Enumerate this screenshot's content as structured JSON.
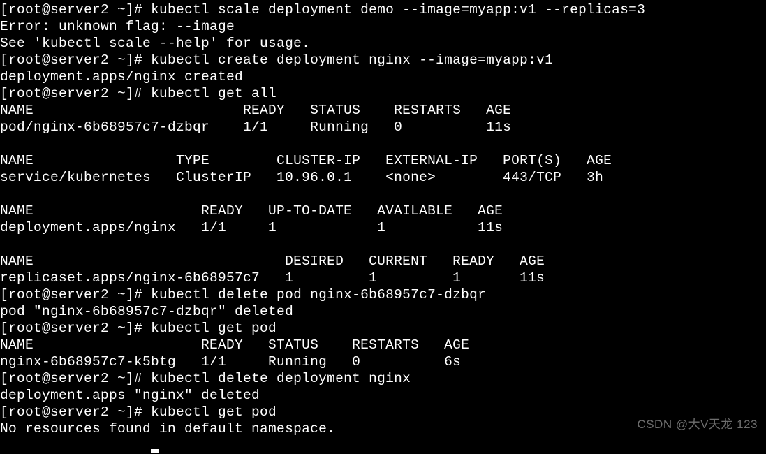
{
  "prompt": "[root@server2 ~]# ",
  "blocks": [
    {
      "cmd": "kubectl scale deployment demo --image=myapp:v1 --replicas=3",
      "out": [
        "Error: unknown flag: --image",
        "See 'kubectl scale --help' for usage."
      ]
    },
    {
      "cmd": "kubectl create deployment nginx --image=myapp:v1",
      "out": [
        "deployment.apps/nginx created"
      ]
    },
    {
      "cmd": "kubectl get all",
      "out": [
        "NAME                         READY   STATUS    RESTARTS   AGE",
        "pod/nginx-6b68957c7-dzbqr    1/1     Running   0          11s",
        "",
        "NAME                 TYPE        CLUSTER-IP   EXTERNAL-IP   PORT(S)   AGE",
        "service/kubernetes   ClusterIP   10.96.0.1    <none>        443/TCP   3h",
        "",
        "NAME                    READY   UP-TO-DATE   AVAILABLE   AGE",
        "deployment.apps/nginx   1/1     1            1           11s",
        "",
        "NAME                              DESIRED   CURRENT   READY   AGE",
        "replicaset.apps/nginx-6b68957c7   1         1         1       11s"
      ]
    },
    {
      "cmd": "kubectl delete pod nginx-6b68957c7-dzbqr",
      "out": [
        "pod \"nginx-6b68957c7-dzbqr\" deleted"
      ]
    },
    {
      "cmd": "kubectl get pod",
      "out": [
        "NAME                    READY   STATUS    RESTARTS   AGE",
        "nginx-6b68957c7-k5btg   1/1     Running   0          6s"
      ]
    },
    {
      "cmd": "kubectl delete deployment nginx",
      "out": [
        "deployment.apps \"nginx\" deleted"
      ]
    },
    {
      "cmd": "kubectl get pod",
      "out": [
        "No resources found in default namespace."
      ]
    }
  ],
  "watermark": "CSDN @大V天龙 123"
}
